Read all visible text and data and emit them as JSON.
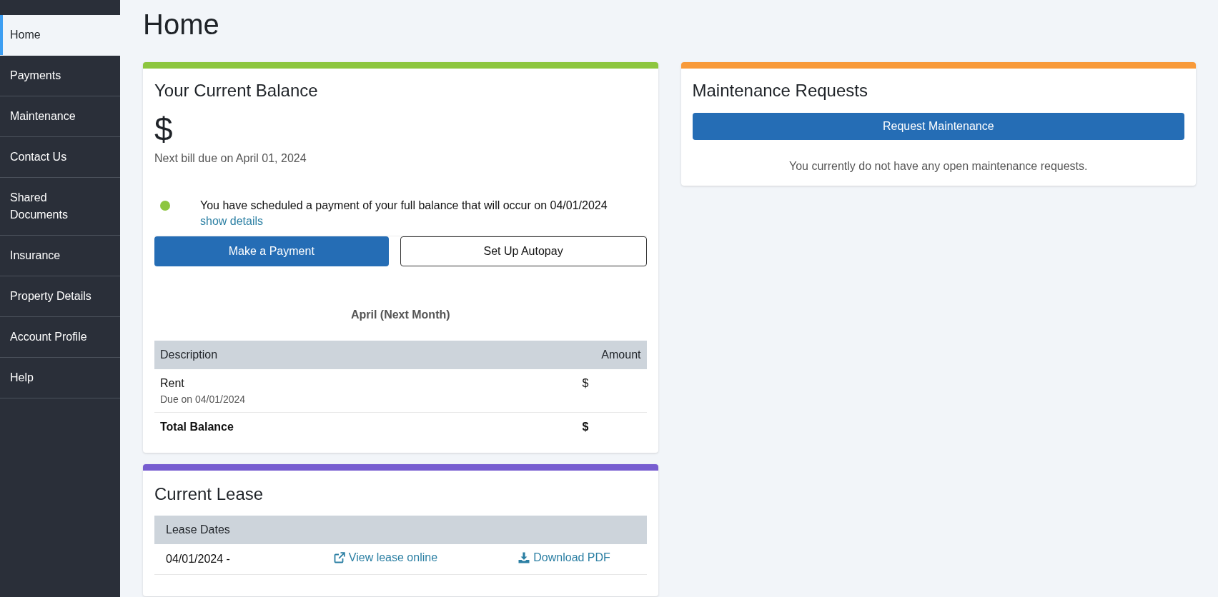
{
  "sidebar": {
    "items": [
      {
        "label": "Home",
        "selected": true
      },
      {
        "label": "Payments",
        "selected": false
      },
      {
        "label": "Maintenance",
        "selected": false
      },
      {
        "label": "Contact Us",
        "selected": false
      },
      {
        "label": "Shared Documents",
        "selected": false
      },
      {
        "label": "Insurance",
        "selected": false
      },
      {
        "label": "Property Details",
        "selected": false
      },
      {
        "label": "Account Profile",
        "selected": false
      },
      {
        "label": "Help",
        "selected": false
      }
    ]
  },
  "page_title": "Home",
  "columns": [
    {
      "cards": [
        {
          "kind": "balance",
          "color": "#8dc63f",
          "title": "Your Current Balance",
          "amount": "$",
          "next_bill": "Next bill due on April 01, 2024",
          "scheduled_payment": {
            "text": "You have scheduled a payment of your full balance that will occur on 04/01/2024",
            "link": "show details"
          },
          "buttons": [
            {
              "kind": "primary",
              "label": "Make a Payment"
            },
            {
              "kind": "outline",
              "label": "Set Up Autopay"
            }
          ],
          "bill": {
            "caption": "April (Next Month)",
            "columns": [
              "Description",
              "Amount"
            ],
            "rows": [
              {
                "kind": "item",
                "description": "Rent",
                "note": "Due on 04/01/2024",
                "amount": "$"
              },
              {
                "kind": "total",
                "description": "Total Balance",
                "amount": "$"
              }
            ]
          }
        },
        {
          "kind": "lease",
          "color": "#775dd0",
          "title": "Current Lease",
          "table": {
            "columns": [
              "Lease Dates"
            ],
            "rows": [
              {
                "dates": "04/01/2024 -",
                "view_link": "View lease online",
                "download_link": "Download PDF"
              }
            ]
          }
        }
      ]
    },
    {
      "cards": [
        {
          "kind": "maintenance",
          "color": "#f89a3a",
          "title": "Maintenance Requests",
          "button": "Request Maintenance",
          "message": "You currently do not have any open maintenance requests."
        }
      ]
    }
  ]
}
